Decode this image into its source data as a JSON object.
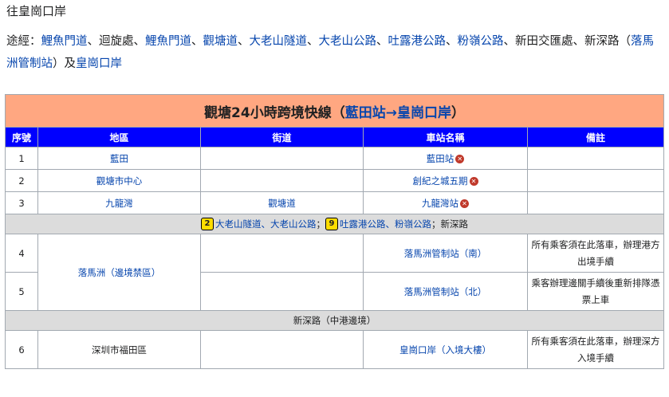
{
  "heading": "往皇崗口岸",
  "via": {
    "prefix": "途經：",
    "parts": [
      {
        "text": "鯉魚門道",
        "link": true
      },
      {
        "text": "、迴旋處、",
        "link": false
      },
      {
        "text": "鯉魚門道",
        "link": true
      },
      {
        "text": "、",
        "link": false
      },
      {
        "text": "觀塘道",
        "link": true
      },
      {
        "text": "、",
        "link": false
      },
      {
        "text": "大老山隧道",
        "link": true
      },
      {
        "text": "、",
        "link": false
      },
      {
        "text": "大老山公路",
        "link": true
      },
      {
        "text": "、",
        "link": false
      },
      {
        "text": "吐露港公路",
        "link": true
      },
      {
        "text": "、",
        "link": false
      },
      {
        "text": "粉嶺公路",
        "link": true
      },
      {
        "text": "、新田交匯處、新深路（",
        "link": false
      },
      {
        "text": "落馬洲管制站",
        "link": true
      },
      {
        "text": "）及",
        "link": false
      },
      {
        "text": "皇崗口岸",
        "link": true
      }
    ]
  },
  "table": {
    "title_prefix": "觀塘24小時跨境快線（",
    "title_link": "藍田站→皇崗口岸",
    "title_suffix": "）",
    "headers": [
      "序號",
      "地區",
      "街道",
      "車站名稱",
      "備註"
    ],
    "rows": [
      {
        "no": "1",
        "district": "藍田",
        "street": "",
        "station": "藍田站",
        "x": true,
        "note": ""
      },
      {
        "no": "2",
        "district": "觀塘市中心",
        "street": "",
        "station": "創紀之城五期",
        "x": true,
        "note": ""
      },
      {
        "no": "3",
        "district": "九龍灣",
        "street": "觀塘道",
        "station": "九龍灣站",
        "x": true,
        "note": ""
      }
    ],
    "gray1": {
      "badge1": "2",
      "text1": "大老山隧道、大老山公路",
      "sep": "；",
      "badge2": "9",
      "text2": "吐露港公路、粉嶺公路",
      "text3": "；新深路"
    },
    "rows2": [
      {
        "no": "4",
        "station": "落馬洲管制站（南）",
        "note": "所有乘客須在此落車，辦理港方出境手續"
      },
      {
        "no": "5",
        "station": "落馬洲管制站（北）",
        "note": "乘客辦理邊關手續後重新排隊憑票上車"
      }
    ],
    "district_merged": "落馬洲（邊境禁區）",
    "gray2": "新深路（中港邊境）",
    "row6": {
      "no": "6",
      "district": "深圳市福田區",
      "station": "皇崗口岸（入境大樓）",
      "note": "所有乘客須在此落車，辦理深方入境手續"
    },
    "x_symbol": "✕"
  }
}
